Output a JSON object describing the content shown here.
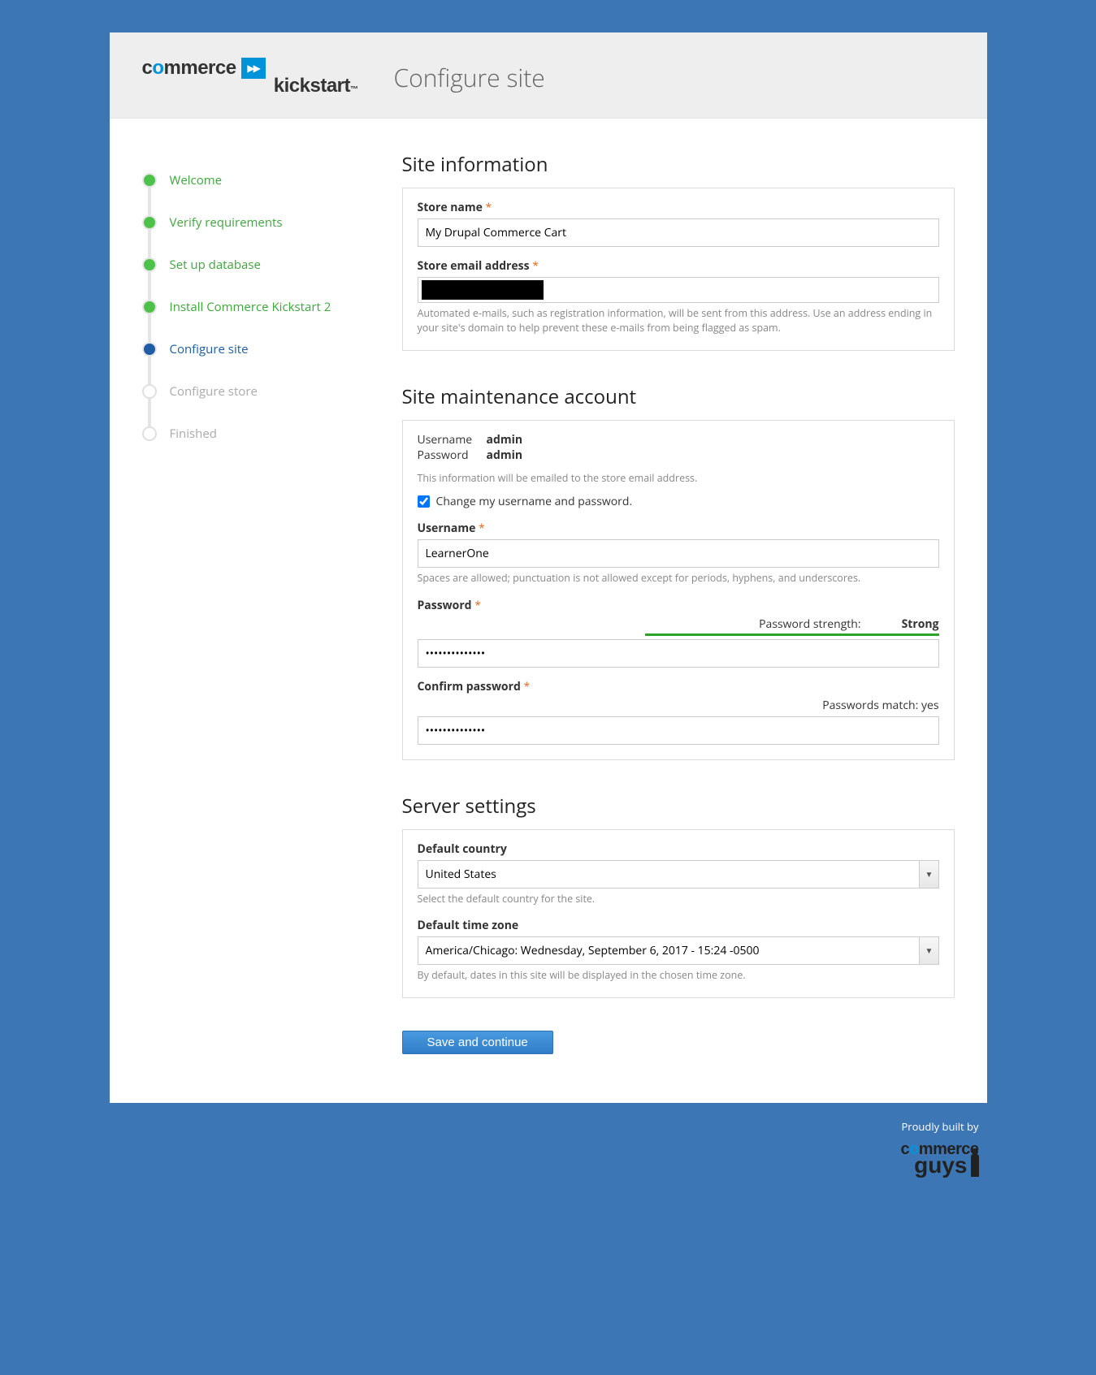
{
  "header": {
    "logo_commerce": "commerce",
    "logo_kickstart": "kickstart",
    "logo_badge": "▶▶",
    "page_title": "Configure site"
  },
  "steps": [
    {
      "label": "Welcome",
      "state": "done"
    },
    {
      "label": "Verify requirements",
      "state": "done"
    },
    {
      "label": "Set up database",
      "state": "done"
    },
    {
      "label": "Install Commerce Kickstart 2",
      "state": "done"
    },
    {
      "label": "Configure site",
      "state": "current"
    },
    {
      "label": "Configure store",
      "state": "pending"
    },
    {
      "label": "Finished",
      "state": "pending"
    }
  ],
  "site_info": {
    "title": "Site information",
    "store_name_label": "Store name",
    "store_name_value": "My Drupal Commerce Cart",
    "store_email_label": "Store email address",
    "store_email_help": "Automated e-mails, such as registration information, will be sent from this address. Use an address ending in your site's domain to help prevent these e-mails from being flagged as spam."
  },
  "maint": {
    "title": "Site maintenance account",
    "username_key": "Username",
    "username_val": "admin",
    "password_key": "Password",
    "password_val": "admin",
    "emailed_note": "This information will be emailed to the store email address.",
    "change_checkbox_label": "Change my username and password.",
    "change_checked": true,
    "username_label": "Username",
    "username_value": "LearnerOne",
    "username_help": "Spaces are allowed; punctuation is not allowed except for periods, hyphens, and underscores.",
    "password_label": "Password",
    "password_value": "••••••••••••••",
    "strength_label": "Password strength:",
    "strength_value": "Strong",
    "confirm_label": "Confirm password",
    "confirm_value": "••••••••••••••",
    "match_label": "Passwords match:",
    "match_value": "yes"
  },
  "server": {
    "title": "Server settings",
    "country_label": "Default country",
    "country_value": "United States",
    "country_help": "Select the default country for the site.",
    "tz_label": "Default time zone",
    "tz_value": "America/Chicago: Wednesday, September 6, 2017 - 15:24 -0500",
    "tz_help": "By default, dates in this site will be displayed in the chosen time zone."
  },
  "submit_label": "Save and continue",
  "footer": {
    "proudly": "Proudly built by",
    "cg_commerce": "commerce",
    "cg_guys": "guys"
  }
}
